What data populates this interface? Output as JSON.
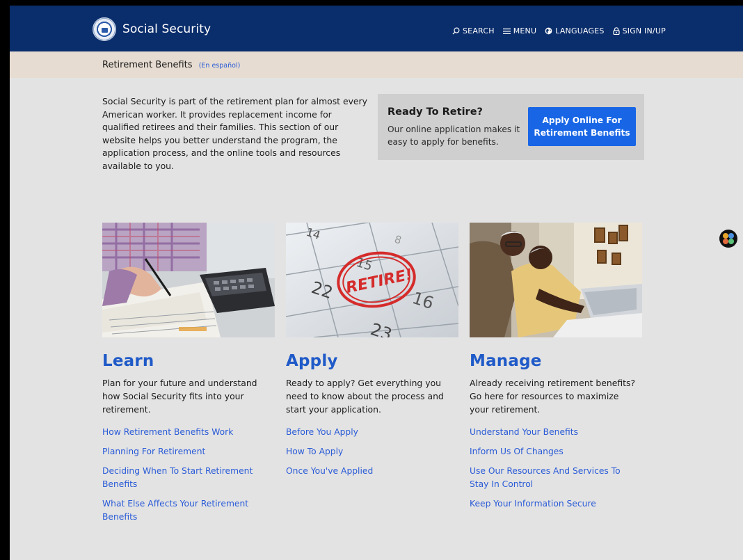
{
  "header": {
    "brand": "Social Security",
    "nav": [
      {
        "label": "SEARCH",
        "icon": "search-icon"
      },
      {
        "label": "MENU",
        "icon": "menu-icon"
      },
      {
        "label": "LANGUAGES",
        "icon": "globe-icon"
      },
      {
        "label": "SIGN IN/UP",
        "icon": "lock-icon"
      }
    ]
  },
  "subheader": {
    "title": "Retirement Benefits",
    "alt_link": "(En español)"
  },
  "intro": {
    "text": "Social Security is part of the retirement plan for almost every American worker. It provides replacement income for qualified retirees and their families. This section of our website helps you better understand the program, the application process, and the online tools and resources available to you."
  },
  "cta": {
    "title": "Ready To Retire?",
    "text": "Our online application makes it easy to apply for benefits.",
    "button": "Apply Online For Retirement Benefits"
  },
  "columns": [
    {
      "heading": "Learn",
      "desc": "Plan for your future and understand how Social Security fits into your retirement.",
      "links": [
        "How Retirement Benefits Work",
        "Planning For Retirement",
        "Deciding When To Start Retirement Benefits",
        "What Else Affects Your Retirement Benefits"
      ]
    },
    {
      "heading": "Apply",
      "desc": "Ready to apply? Get everything you need to know about the process and start your application.",
      "links": [
        "Before You Apply",
        "How To Apply",
        "Once You've Applied"
      ]
    },
    {
      "heading": "Manage",
      "desc": "Already receiving retirement benefits? Go here for resources to maximize your retirement.",
      "links": [
        "Understand Your Benefits",
        "Inform Us Of Changes",
        "Use Our Resources And Services To Stay In Control",
        "Keep Your Information Secure"
      ]
    }
  ],
  "calendar": {
    "numbers": [
      "14",
      "8",
      "15",
      "22",
      "16",
      "23"
    ],
    "stamp": "RETIRE!"
  },
  "colors": {
    "header_bg": "#0a2d6b",
    "subheader_bg": "#e6dcd1",
    "page_bg": "#e3e3e3",
    "accent": "#1f5ac8",
    "link": "#2a5bd7",
    "button": "#1866e6"
  }
}
